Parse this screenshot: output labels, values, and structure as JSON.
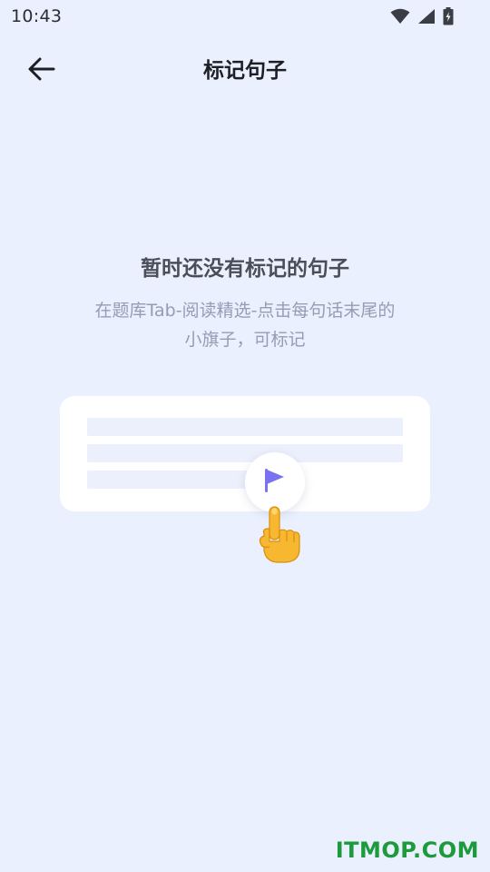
{
  "status_bar": {
    "time": "10:43",
    "icons": [
      "wifi-icon",
      "signal-icon",
      "battery-charging-icon"
    ]
  },
  "header": {
    "title": "标记句子",
    "back_icon": "arrow-left-icon"
  },
  "empty_state": {
    "title": "暂时还没有标记的句子",
    "description_line1": "在题库Tab-阅读精选-点击每句话末尾的",
    "description_line2": "小旗子，可标记",
    "illustration": {
      "flag_icon": "flag-icon",
      "hand_icon": "pointing-hand-icon",
      "flag_color": "#7b72f2",
      "hand_color": "#f7b731"
    }
  },
  "watermark": {
    "text": "ITMOP.COM",
    "color": "#1c9a3c"
  },
  "colors": {
    "background": "#eaf0fd",
    "card": "#ffffff",
    "card_line": "#ecf0fc",
    "title_text": "#1d1f24",
    "empty_title_text": "#4a4e59",
    "description_text": "#969cb4"
  }
}
